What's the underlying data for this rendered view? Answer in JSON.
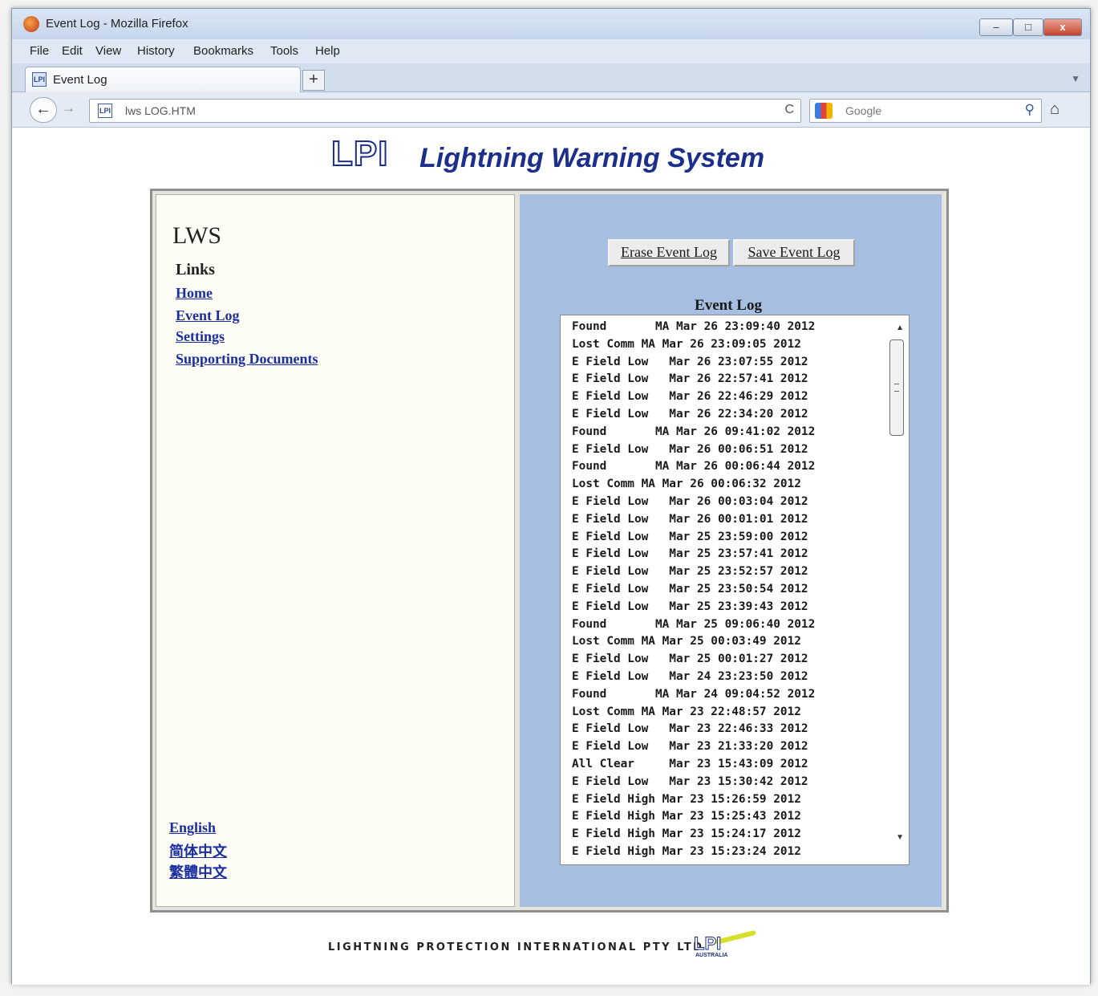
{
  "browser": {
    "window_title": "Event Log - Mozilla Firefox",
    "window_buttons": {
      "minimize": "–",
      "maximize": "□",
      "close": "x"
    },
    "menu": [
      "File",
      "Edit",
      "View",
      "History",
      "Bookmarks",
      "Tools",
      "Help"
    ],
    "tab": {
      "label": "Event Log",
      "icon": "lpi-favicon",
      "icon_text": "LPI"
    },
    "new_tab": "+",
    "tab_list": "▼",
    "back": "←",
    "forward": "→",
    "url": "lws LOG.HTM",
    "reload": "C",
    "search": {
      "placeholder": "Google",
      "go": "⚲"
    },
    "home": "⌂"
  },
  "page": {
    "logo": {
      "mark": "LPI",
      "text": "Lightning Warning System"
    },
    "sidebar": {
      "title": "LWS",
      "links_heading": "Links",
      "links": [
        "Home",
        "Event Log",
        "Settings",
        "Supporting Documents"
      ],
      "languages": [
        "English",
        "简体中文",
        "繁體中文"
      ]
    },
    "buttons": {
      "erase": "Erase Event Log",
      "save": "Save Event Log"
    },
    "event_log": {
      "heading": "Event Log",
      "entries": [
        "Found       MA Mar 26 23:09:40 2012",
        "Lost Comm MA Mar 26 23:09:05 2012",
        "E Field Low   Mar 26 23:07:55 2012",
        "E Field Low   Mar 26 22:57:41 2012",
        "E Field Low   Mar 26 22:46:29 2012",
        "E Field Low   Mar 26 22:34:20 2012",
        "Found       MA Mar 26 09:41:02 2012",
        "E Field Low   Mar 26 00:06:51 2012",
        "Found       MA Mar 26 00:06:44 2012",
        "Lost Comm MA Mar 26 00:06:32 2012",
        "E Field Low   Mar 26 00:03:04 2012",
        "E Field Low   Mar 26 00:01:01 2012",
        "E Field Low   Mar 25 23:59:00 2012",
        "E Field Low   Mar 25 23:57:41 2012",
        "E Field Low   Mar 25 23:52:57 2012",
        "E Field Low   Mar 25 23:50:54 2012",
        "E Field Low   Mar 25 23:39:43 2012",
        "Found       MA Mar 25 09:06:40 2012",
        "Lost Comm MA Mar 25 00:03:49 2012",
        "E Field Low   Mar 25 00:01:27 2012",
        "E Field Low   Mar 24 23:23:50 2012",
        "Found       MA Mar 24 09:04:52 2012",
        "Lost Comm MA Mar 23 22:48:57 2012",
        "E Field Low   Mar 23 22:46:33 2012",
        "E Field Low   Mar 23 21:33:20 2012",
        "All Clear     Mar 23 15:43:09 2012",
        "E Field Low   Mar 23 15:30:42 2012",
        "E Field High Mar 23 15:26:59 2012",
        "E Field High Mar 23 15:25:43 2012",
        "E Field High Mar 23 15:24:17 2012",
        "E Field High Mar 23 15:23:24 2012"
      ]
    },
    "footer": {
      "company": "LIGHTNING PROTECTION INTERNATIONAL PTY LTD",
      "logo_mark": "LPI",
      "logo_sub": "AUSTRALIA"
    }
  },
  "colors": {
    "accent_blue": "#1c2f8a",
    "link": "#1a2ea0",
    "right_panel": "#a6bfe0",
    "left_panel": "#fdfdf6"
  }
}
